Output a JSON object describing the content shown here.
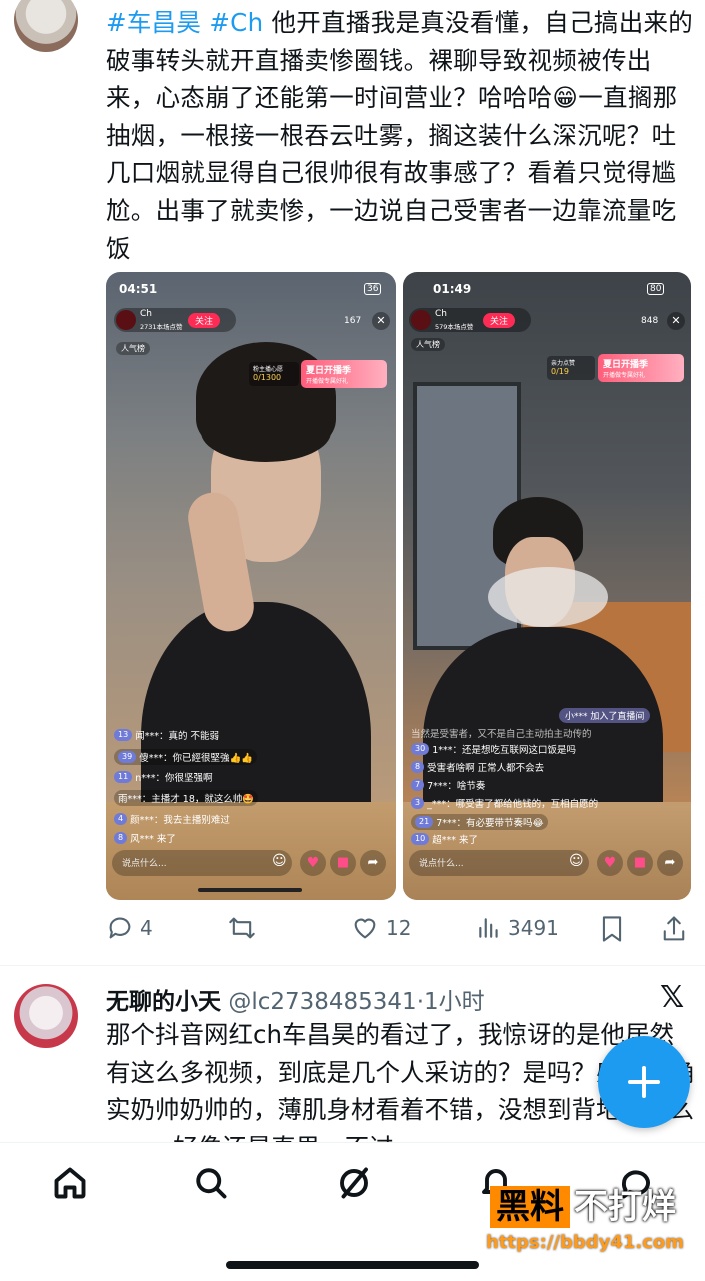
{
  "post": {
    "tag1": "#车昌昊",
    "tag2": "#Ch",
    "text": " 他开直播我是真没看懂，自己搞出来的破事转头就开直播卖惨圈钱。裸聊导致视频被传出来，心态崩了还能第一时间营业？哈哈哈😁一直搁那抽烟，一根接一根吞云吐雾，搁这装什么深沉呢？吐几口烟就显得自己很帅很有故事感了？看着只觉得尴尬。出事了就卖惨，一边说自己受害者一边靠流量吃饭"
  },
  "media_left": {
    "time": "04:51",
    "battery": "36",
    "streamer": "Ch",
    "streamer_sub": "2731本场点赞",
    "follow": "关注",
    "viewers": "167",
    "rank": "人气榜",
    "goal_label": "粉主播心愿",
    "goal": "0/1300",
    "event_title": "夏日开播季",
    "event_sub": "开播做专属好礼",
    "chat": [
      {
        "lvl": "13",
        "text": "闻***：真的 不能弱"
      },
      {
        "lvl": "39",
        "text": "傻***：你已經很堅強👍👍"
      },
      {
        "lvl": "11",
        "text": "n***：你很坚强啊"
      },
      {
        "lvl": "",
        "text": "雨***：主播才 18，就这么帅🤩"
      },
      {
        "lvl": "4",
        "text": "颜***：我去主播别难过"
      },
      {
        "lvl": "8",
        "text": "风*** 来了"
      }
    ],
    "input_placeholder": "说点什么..."
  },
  "media_right": {
    "time": "01:49",
    "battery": "80",
    "streamer": "Ch",
    "streamer_sub": "579本场点赞",
    "follow": "关注",
    "viewers": "848",
    "rank": "人气榜",
    "goal_label": "亲力点赞",
    "goal": "0/19",
    "event_title": "夏日开播季",
    "event_sub": "开播做专属好礼",
    "join_notice": "小*** 加入了直播间",
    "chat": [
      {
        "lvl": "",
        "text": "当然是受害者，又不是自己主动拍主动传的"
      },
      {
        "lvl": "30",
        "text": "1***：还是想吃互联网这口饭是吗"
      },
      {
        "lvl": "8",
        "text": "受害者啥啊 正常人都不会去"
      },
      {
        "lvl": "7",
        "text": "7***：啥节奏"
      },
      {
        "lvl": "3",
        "text": "_***：哪受害了都给他钱的，互相自愿的"
      },
      {
        "lvl": "21",
        "text": "7***：有必要带节奏吗😂"
      },
      {
        "lvl": "10",
        "text": "超*** 来了"
      }
    ],
    "input_placeholder": "说点什么..."
  },
  "actions": {
    "replies": "4",
    "reposts": "",
    "likes": "12",
    "views": "3491"
  },
  "reply": {
    "name": "无聊的小天",
    "handle": "@lc2738485341",
    "time": "·1小时",
    "text": "那个抖音网红ch车昌昊的看过了，我惊讶的是他居然有这么多视频，到底是几个人采访的？是吗？感觉他确实奶帅奶帅的，薄肌身材看着不错，没想到背地里这么sao，好像还是直男，不过"
  },
  "watermark": {
    "part1": "黑料",
    "part2": "不打烊",
    "url": "https://bbdy41.com"
  },
  "colors": {
    "link": "#1d9bf0",
    "fab": "#1d9bf0",
    "secondary_text": "#536471"
  }
}
